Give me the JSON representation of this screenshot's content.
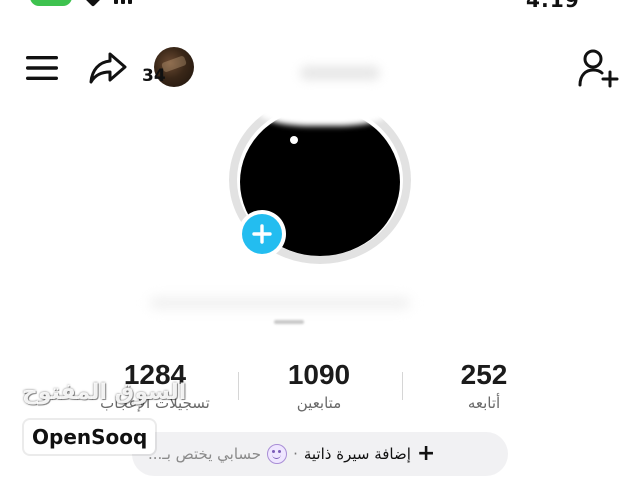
{
  "status_bar": {
    "time": "4:19"
  },
  "header": {
    "menu_icon": "hamburger-menu-icon",
    "share_icon": "share-arrow-icon",
    "follow_icon": "add-user-icon",
    "mini_avatar_count": "34"
  },
  "profile": {
    "add_photo_icon": "plus-icon",
    "accent_color": "#23bdf0"
  },
  "stats": [
    {
      "value": "1284",
      "label": "تسجيلات الإعجاب"
    },
    {
      "value": "1090",
      "label": "متابعين"
    },
    {
      "value": "252",
      "label": "أتابعه"
    }
  ],
  "bio": {
    "add_label": "إضافة سيرة ذاتية",
    "separator": "·",
    "placeholder": "حسابي يختص بـ...",
    "plus_icon": "plus-icon",
    "emoji_icon": "smiley-face-icon"
  },
  "watermark": {
    "arabic": "السوق المفتوح",
    "brand": "OpenSooq"
  }
}
